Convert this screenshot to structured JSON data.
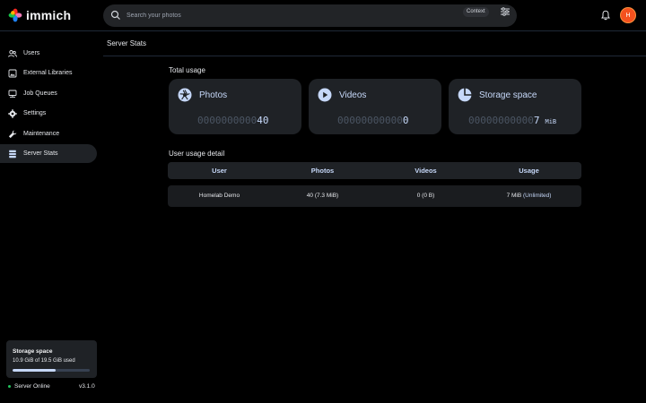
{
  "app": {
    "name": "immich"
  },
  "header": {
    "search_placeholder": "Search your photos",
    "context_label": "Context",
    "avatar_initial": "H"
  },
  "sidebar": {
    "items": [
      {
        "label": "Users",
        "icon": "users-icon",
        "active": false
      },
      {
        "label": "External Libraries",
        "icon": "library-icon",
        "active": false
      },
      {
        "label": "Job Queues",
        "icon": "jobs-icon",
        "active": false
      },
      {
        "label": "Settings",
        "icon": "gear-icon",
        "active": false
      },
      {
        "label": "Maintenance",
        "icon": "wrench-icon",
        "active": false
      },
      {
        "label": "Server Stats",
        "icon": "server-icon",
        "active": true
      }
    ],
    "storage": {
      "title": "Storage space",
      "used_text": "10.9 GiB of 19.5 GiB used",
      "used_fraction": 0.56
    },
    "status": "Server Online",
    "version": "v3.1.0"
  },
  "main": {
    "page_title": "Server Stats",
    "total_usage_label": "Total usage",
    "cards": [
      {
        "title": "Photos",
        "zeros": "0000000000",
        "value": "40",
        "unit": ""
      },
      {
        "title": "Videos",
        "zeros": "00000000000",
        "value": "0",
        "unit": ""
      },
      {
        "title": "Storage space",
        "zeros": "00000000000",
        "value": "7",
        "unit": "MiB"
      }
    ],
    "user_detail_label": "User usage detail",
    "table": {
      "headers": [
        "User",
        "Photos",
        "Videos",
        "Usage"
      ],
      "rows": [
        {
          "user": "Homelab Demo",
          "photos": "40 (7.3 MiB)",
          "videos": "0 (0 B)",
          "usage": "7 MiB",
          "limit": "(Unlimited)"
        }
      ]
    }
  },
  "colors": {
    "accent": "#c6d8f9",
    "card_bg": "#1f2226",
    "status_online": "#22c55e",
    "avatar": "#f4511e"
  }
}
